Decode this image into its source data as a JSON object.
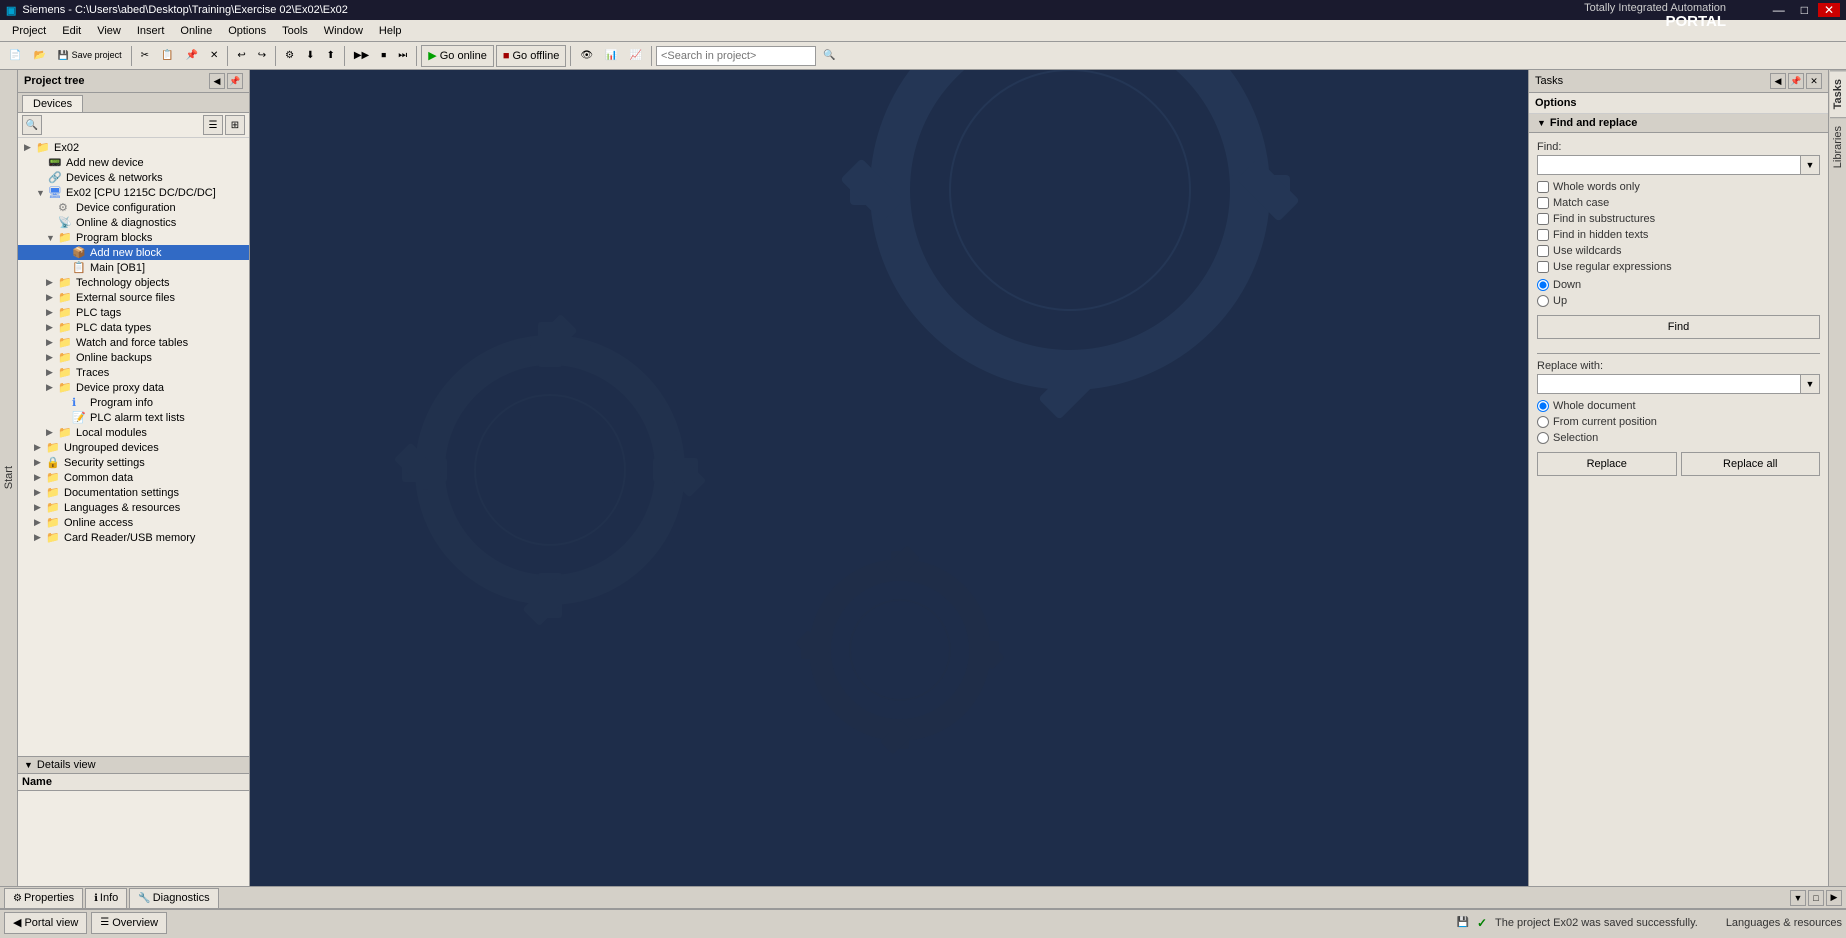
{
  "titlebar": {
    "title": "Siemens - C:\\Users\\abed\\Desktop\\Training\\Exercise 02\\Ex02\\Ex02",
    "brand": "Totally Integrated Automation",
    "brand_sub": "PORTAL",
    "close": "✕",
    "maximize": "□",
    "minimize": "—"
  },
  "menubar": {
    "items": [
      "Project",
      "Edit",
      "View",
      "Insert",
      "Online",
      "Options",
      "Tools",
      "Window",
      "Help"
    ]
  },
  "toolbar": {
    "go_online": "Go online",
    "go_offline": "Go offline",
    "search_placeholder": "<Search in project>"
  },
  "project_tree": {
    "header": "Project tree",
    "tab_devices": "Devices",
    "nodes": [
      {
        "id": "ex02",
        "label": "Ex02",
        "level": 0,
        "expanded": true,
        "arrow": "▶",
        "type": "folder"
      },
      {
        "id": "add-device",
        "label": "Add new device",
        "level": 1,
        "expanded": false,
        "arrow": "",
        "type": "add"
      },
      {
        "id": "devices-networks",
        "label": "Devices & networks",
        "level": 1,
        "expanded": false,
        "arrow": "",
        "type": "network"
      },
      {
        "id": "cpu",
        "label": "Ex02 [CPU 1215C DC/DC/DC]",
        "level": 1,
        "expanded": true,
        "arrow": "▼",
        "type": "cpu"
      },
      {
        "id": "device-config",
        "label": "Device configuration",
        "level": 2,
        "expanded": false,
        "arrow": "",
        "type": "gear"
      },
      {
        "id": "online-diag",
        "label": "Online & diagnostics",
        "level": 2,
        "expanded": false,
        "arrow": "",
        "type": "diag"
      },
      {
        "id": "program-blocks",
        "label": "Program blocks",
        "level": 2,
        "expanded": true,
        "arrow": "▼",
        "type": "folder"
      },
      {
        "id": "add-block",
        "label": "Add new block",
        "level": 3,
        "expanded": false,
        "arrow": "",
        "type": "add",
        "selected": true
      },
      {
        "id": "main-ob1",
        "label": "Main [OB1]",
        "level": 3,
        "expanded": false,
        "arrow": "",
        "type": "ob"
      },
      {
        "id": "tech-objects",
        "label": "Technology objects",
        "level": 2,
        "expanded": false,
        "arrow": "▶",
        "type": "folder"
      },
      {
        "id": "ext-sources",
        "label": "External source files",
        "level": 2,
        "expanded": false,
        "arrow": "▶",
        "type": "folder"
      },
      {
        "id": "plc-tags",
        "label": "PLC tags",
        "level": 2,
        "expanded": false,
        "arrow": "▶",
        "type": "folder"
      },
      {
        "id": "plc-data-types",
        "label": "PLC data types",
        "level": 2,
        "expanded": false,
        "arrow": "▶",
        "type": "folder"
      },
      {
        "id": "watch-force",
        "label": "Watch and force tables",
        "level": 2,
        "expanded": false,
        "arrow": "▶",
        "type": "folder"
      },
      {
        "id": "online-backups",
        "label": "Online backups",
        "level": 2,
        "expanded": false,
        "arrow": "▶",
        "type": "folder"
      },
      {
        "id": "traces",
        "label": "Traces",
        "level": 2,
        "expanded": false,
        "arrow": "▶",
        "type": "folder"
      },
      {
        "id": "device-proxy",
        "label": "Device proxy data",
        "level": 2,
        "expanded": false,
        "arrow": "▶",
        "type": "folder"
      },
      {
        "id": "program-info",
        "label": "Program info",
        "level": 2,
        "expanded": false,
        "arrow": "",
        "type": "info"
      },
      {
        "id": "plc-alarm",
        "label": "PLC alarm text lists",
        "level": 2,
        "expanded": false,
        "arrow": "",
        "type": "list"
      },
      {
        "id": "local-modules",
        "label": "Local modules",
        "level": 2,
        "expanded": false,
        "arrow": "▶",
        "type": "folder"
      },
      {
        "id": "ungrouped",
        "label": "Ungrouped devices",
        "level": 1,
        "expanded": false,
        "arrow": "▶",
        "type": "folder"
      },
      {
        "id": "security",
        "label": "Security settings",
        "level": 1,
        "expanded": false,
        "arrow": "▶",
        "type": "security"
      },
      {
        "id": "common-data",
        "label": "Common data",
        "level": 1,
        "expanded": false,
        "arrow": "▶",
        "type": "folder"
      },
      {
        "id": "doc-settings",
        "label": "Documentation settings",
        "level": 1,
        "expanded": false,
        "arrow": "▶",
        "type": "folder"
      },
      {
        "id": "languages",
        "label": "Languages & resources",
        "level": 1,
        "expanded": false,
        "arrow": "▶",
        "type": "folder"
      },
      {
        "id": "online-access",
        "label": "Online access",
        "level": 1,
        "expanded": false,
        "arrow": "▶",
        "type": "folder"
      },
      {
        "id": "card-reader",
        "label": "Card Reader/USB memory",
        "level": 1,
        "expanded": false,
        "arrow": "▶",
        "type": "folder"
      }
    ]
  },
  "details_view": {
    "label": "Details view",
    "columns": [
      "Name"
    ]
  },
  "tasks_panel": {
    "header": "Tasks",
    "options_label": "Options",
    "find_replace": {
      "title": "Find and replace",
      "find_label": "Find:",
      "find_placeholder": "",
      "whole_words_only": "Whole words only",
      "match_case": "Match case",
      "find_in_substructures": "Find in substructures",
      "find_in_hidden": "Find in hidden texts",
      "use_wildcards": "Use wildcards",
      "use_regex": "Use regular expressions",
      "direction_down": "Down",
      "direction_up": "Up",
      "find_btn": "Find",
      "replace_label": "Replace with:",
      "replace_placeholder": "",
      "whole_document": "Whole document",
      "from_current": "From current position",
      "selection": "Selection",
      "replace_btn": "Replace",
      "replace_all_btn": "Replace all"
    }
  },
  "vtabs": {
    "items": [
      "Tasks",
      "Libraries"
    ]
  },
  "status_bar": {
    "properties_tab": "Properties",
    "info_tab": "Info",
    "diagnostics_tab": "Diagnostics",
    "status_msg": "The project Ex02 was saved successfully.",
    "portal_view": "Portal view",
    "overview": "Overview",
    "languages_resources": "Languages & resources"
  },
  "icons": {
    "arrow_right": "▶",
    "arrow_down": "▼",
    "arrow_left": "◀",
    "check": "✓",
    "expand": "⊞",
    "collapse": "⊟",
    "folder": "📁",
    "gear": "⚙",
    "add": "➕",
    "info": "ℹ",
    "search": "🔍"
  }
}
